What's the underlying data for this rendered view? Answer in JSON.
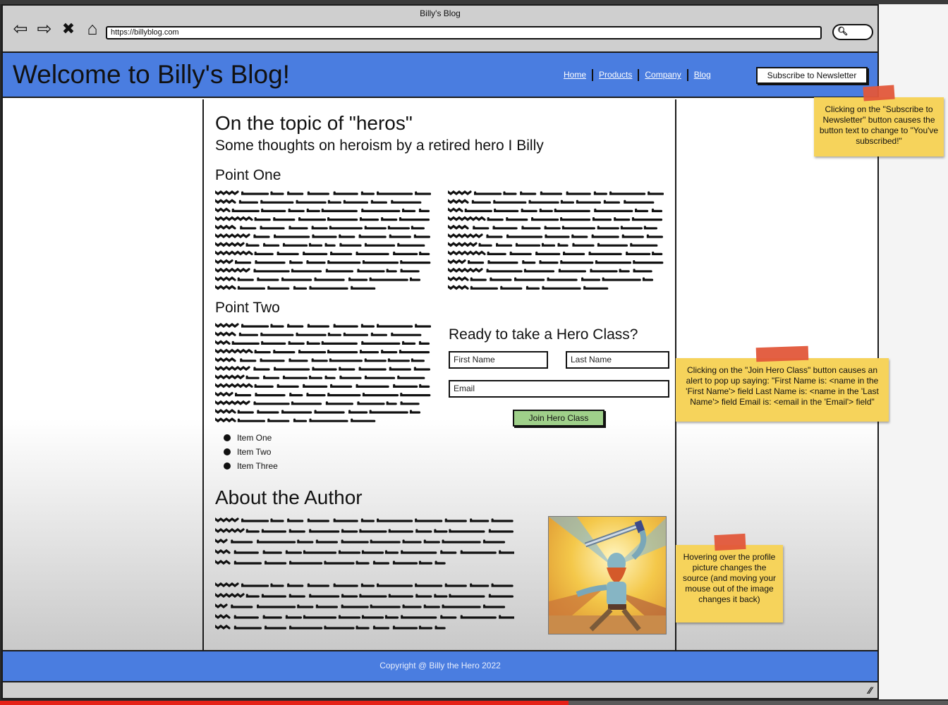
{
  "window": {
    "title": "Billy's Blog"
  },
  "browser": {
    "url": "https://billyblog.com"
  },
  "header": {
    "site_title": "Welcome to Billy's Blog!",
    "nav": [
      "Home",
      "Products",
      "Company",
      "Blog"
    ],
    "subscribe_label": "Subscribe to Newsletter"
  },
  "article": {
    "title": "On the topic of \"heros\"",
    "subtitle": "Some thoughts on heroism by a retired hero I Billy",
    "point_one": "Point One",
    "point_two": "Point Two",
    "list_items": [
      "Item One",
      "Item Two",
      "Item Three"
    ],
    "about_title": "About the Author"
  },
  "form": {
    "title": "Ready to take a Hero Class?",
    "first_name_placeholder": "First Name",
    "last_name_placeholder": "Last Name",
    "email_placeholder": "Email",
    "join_label": "Join Hero Class"
  },
  "footer": {
    "copyright": "Copyright @ Billy the Hero 2022"
  },
  "notes": [
    {
      "text": "Clicking on the \"Subscribe to Newsletter\" button causes the button text to change to \"You've subscribed!\""
    },
    {
      "text": "Clicking on the \"Join Hero Class\" button causes an alert to pop up saying: \"First Name is: <name in the 'First Name'> field Last Name is: <name in the 'Last Name'> field Email is: <email in the 'Email'> field\""
    },
    {
      "text": "Hovering over the profile picture changes the source (and moving your mouse out of the image changes it back)"
    }
  ],
  "video_progress": 0.6,
  "colors": {
    "header": "#4a7de0",
    "join_button": "#9fd08a",
    "sticky_note": "#f6d35b",
    "tape": "#e2573a"
  }
}
